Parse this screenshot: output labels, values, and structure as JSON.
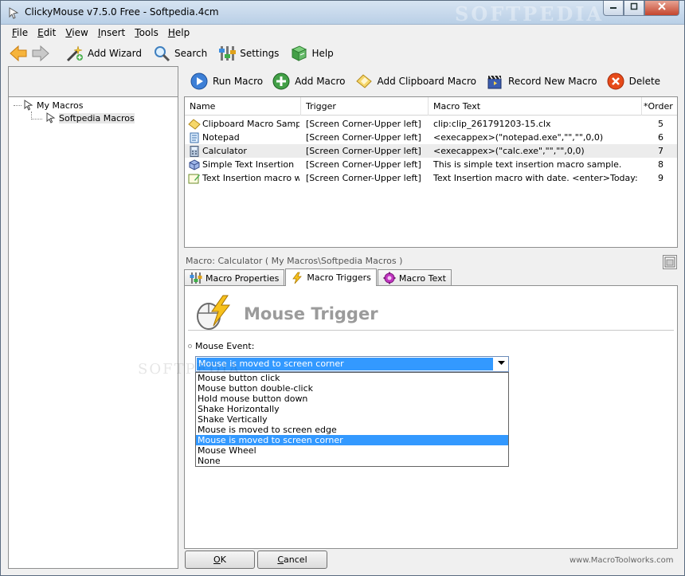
{
  "window": {
    "title": "ClickyMouse v7.5.0 Free - Softpedia.4cm",
    "watermark": "SOFTPEDIA",
    "caption_buttons": [
      "minimize",
      "maximize",
      "close"
    ]
  },
  "menu": [
    {
      "label": "File",
      "underline": "F",
      "rest": "ile"
    },
    {
      "label": "Edit",
      "underline": "E",
      "rest": "dit"
    },
    {
      "label": "View",
      "underline": "V",
      "rest": "iew"
    },
    {
      "label": "Insert",
      "underline": "I",
      "rest": "nsert"
    },
    {
      "label": "Tools",
      "underline": "T",
      "rest": "ools"
    },
    {
      "label": "Help",
      "underline": "H",
      "rest": "elp"
    }
  ],
  "toolbar": {
    "add_wizard": "Add Wizard",
    "search": "Search",
    "settings": "Settings",
    "help": "Help"
  },
  "tree": {
    "root": "My Macros",
    "child": "Softpedia Macros"
  },
  "macro_toolbar": {
    "run": "Run Macro",
    "add": "Add Macro",
    "add_clipboard": "Add Clipboard Macro",
    "record": "Record New Macro",
    "delete": "Delete"
  },
  "list": {
    "columns": [
      "Name",
      "Trigger",
      "Macro Text",
      "*Order"
    ],
    "rows": [
      {
        "name": "Clipboard Macro Sample",
        "trigger": "[Screen Corner-Upper left]",
        "text": "clip:clip_261791203-15.clx",
        "order": "5",
        "icon": "clipboard-icon"
      },
      {
        "name": "Notepad",
        "trigger": "[Screen Corner-Upper left]",
        "text": "<execappex>(\"notepad.exe\",\"\",\"\",0,0)",
        "order": "6",
        "icon": "notepad-icon"
      },
      {
        "name": "Calculator",
        "trigger": "[Screen Corner-Upper left]",
        "text": "<execappex>(\"calc.exe\",\"\",\"\",0,0)",
        "order": "7",
        "icon": "calculator-icon"
      },
      {
        "name": "Simple Text Insertion",
        "trigger": "[Screen Corner-Upper left]",
        "text": "This is simple text insertion macro sample.",
        "order": "8",
        "icon": "text-cube-icon"
      },
      {
        "name": "Text Insertion macro wit...",
        "trigger": "[Screen Corner-Upper left]",
        "text": "Text Insertion macro with date. <enter>Today: <dat...",
        "order": "9",
        "icon": "text-edit-icon"
      }
    ]
  },
  "detail": {
    "caption": "Macro: Calculator ( My Macros\\Softpedia Macros )",
    "tabs": [
      "Macro Properties",
      "Macro Triggers",
      "Macro Text"
    ],
    "trigger_title": "Mouse Trigger",
    "field_label": "Mouse Event:",
    "selected_event": "Mouse is moved to screen corner",
    "options": [
      "Mouse button click",
      "Mouse button double-click",
      "Hold mouse button down",
      "Shake Horizontally",
      "Shake Vertically",
      "Mouse is moved to screen edge",
      "Mouse is moved to screen corner",
      "Mouse Wheel",
      "None"
    ]
  },
  "buttons": {
    "ok_u": "O",
    "ok_rest": "K",
    "cancel_u": "C",
    "cancel_rest": "ancel"
  },
  "footer": "www.MacroToolworks.com",
  "background_watermark": "SOFTPEDIA"
}
